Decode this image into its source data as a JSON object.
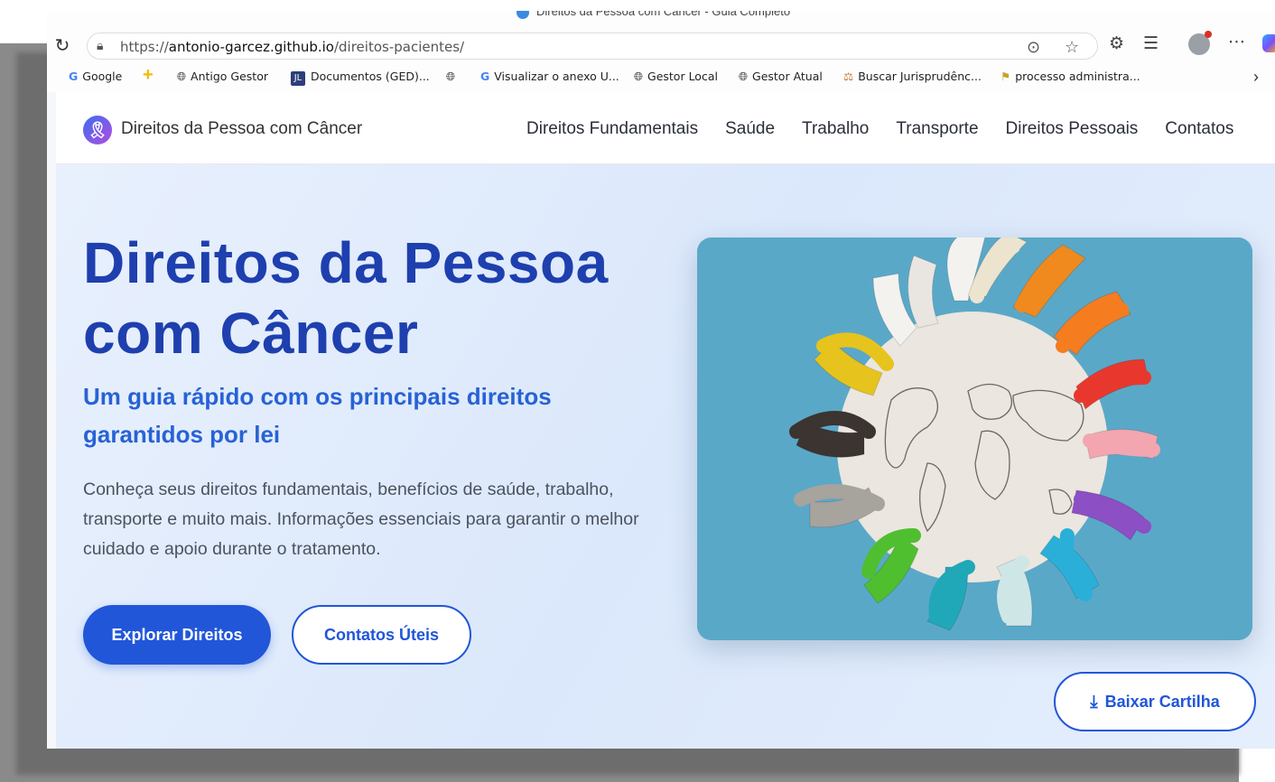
{
  "browser": {
    "tab_title": "Direitos da Pessoa com Câncer - Guia Completo",
    "url_prefix": "https://",
    "url_domain": "antonio-garcez.github.io",
    "url_path": "/direitos-pacientes/",
    "icons": {
      "reload": "reload-icon",
      "lock": "lock-icon",
      "reader": "reader-icon",
      "favorite": "star-icon",
      "extensions": "extensions-icon",
      "favorites_list": "favorites-icon",
      "profile": "profile-icon",
      "more": "more-icon",
      "copilot": "copilot-icon"
    }
  },
  "bookmarks": [
    {
      "label": "Google",
      "icon": "google-icon"
    },
    {
      "label": "",
      "icon": "plus-icon"
    },
    {
      "label": "Antigo Gestor",
      "icon": "globe-icon"
    },
    {
      "label": "Documentos (GED)...",
      "icon": "jl-icon"
    },
    {
      "label": "",
      "icon": "globe-icon"
    },
    {
      "label": "Visualizar o anexo U...",
      "icon": "google-icon"
    },
    {
      "label": "Gestor Local",
      "icon": "globe-icon"
    },
    {
      "label": "Gestor Atual",
      "icon": "globe-icon"
    },
    {
      "label": "Buscar Jurisprudênc...",
      "icon": "scale-icon"
    },
    {
      "label": "processo administra...",
      "icon": "flag-icon"
    }
  ],
  "site": {
    "name": "Direitos da Pessoa com Câncer",
    "logo_icon": "ribbon-icon",
    "nav": [
      "Direitos Fundamentais",
      "Saúde",
      "Trabalho",
      "Transporte",
      "Direitos Pessoais",
      "Contatos"
    ]
  },
  "hero": {
    "title_line1": "Direitos da Pessoa",
    "title_line2": "com Câncer",
    "subtitle": "Um guia rápido com os principais direitos garantidos por lei",
    "description": "Conheça seus direitos fundamentais, benefícios de saúde, trabalho, transporte e muito mais. Informações essenciais para garantir o melhor cuidado e apoio durante o tratamento.",
    "primary_button": "Explorar Direitos",
    "secondary_button": "Contatos Úteis",
    "download_button": "Baixar Cartilha",
    "download_icon": "download-icon",
    "image_subject": "awareness-ribbons-world-map-image"
  },
  "colors": {
    "primary": "#2156d9",
    "title": "#1e3fae",
    "subtitle": "#2762d6",
    "image_bg": "#5aa6c6"
  }
}
